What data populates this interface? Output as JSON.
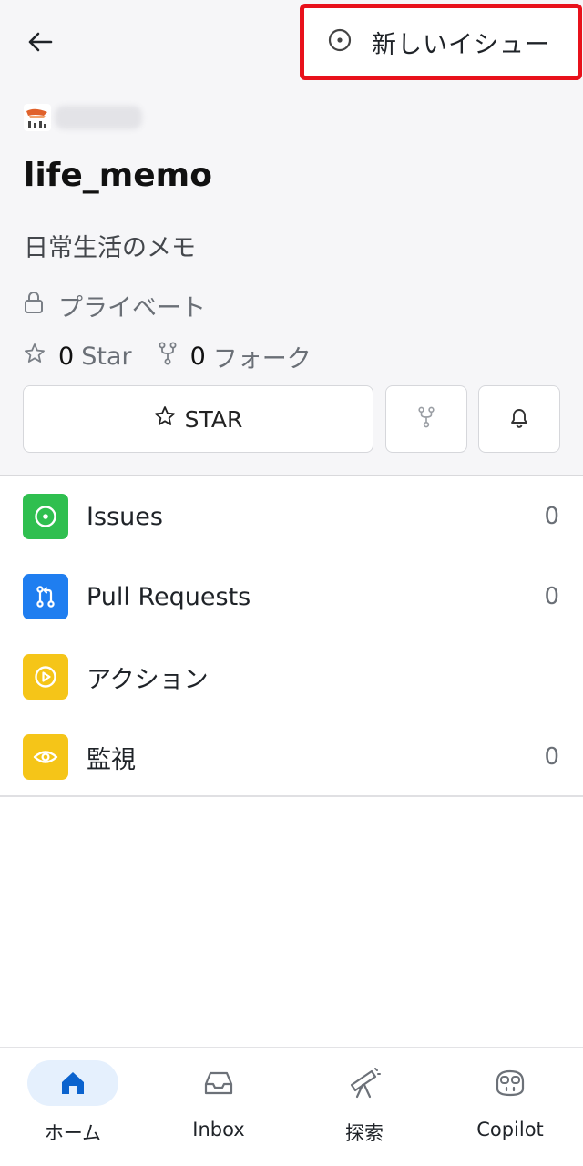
{
  "header": {
    "back_icon": "arrow-left-icon",
    "new_issue_label": "新しいイシュー",
    "new_issue_icon": "issue-circle-icon",
    "highlight_color": "#e8111b"
  },
  "repo": {
    "name": "life_memo",
    "description": "日常生活のメモ",
    "visibility": "プライベート",
    "stars": "0",
    "star_label": "Star",
    "forks": "0",
    "fork_label": "フォーク"
  },
  "actions": {
    "star_button": "STAR"
  },
  "menu": [
    {
      "label": "Issues",
      "count": "0",
      "icon": "issue-icon",
      "color": "#2fbf4f"
    },
    {
      "label": "Pull Requests",
      "count": "0",
      "icon": "pull-request-icon",
      "color": "#1f7ef0"
    },
    {
      "label": "アクション",
      "count": "",
      "icon": "play-icon",
      "color": "#f5c518"
    },
    {
      "label": "監視",
      "count": "0",
      "icon": "eye-icon",
      "color": "#f5c518"
    }
  ],
  "tabs": [
    {
      "label": "ホーム",
      "icon": "home-icon",
      "active": true
    },
    {
      "label": "Inbox",
      "icon": "inbox-icon",
      "active": false
    },
    {
      "label": "探索",
      "icon": "telescope-icon",
      "active": false
    },
    {
      "label": "Copilot",
      "icon": "copilot-icon",
      "active": false
    }
  ]
}
